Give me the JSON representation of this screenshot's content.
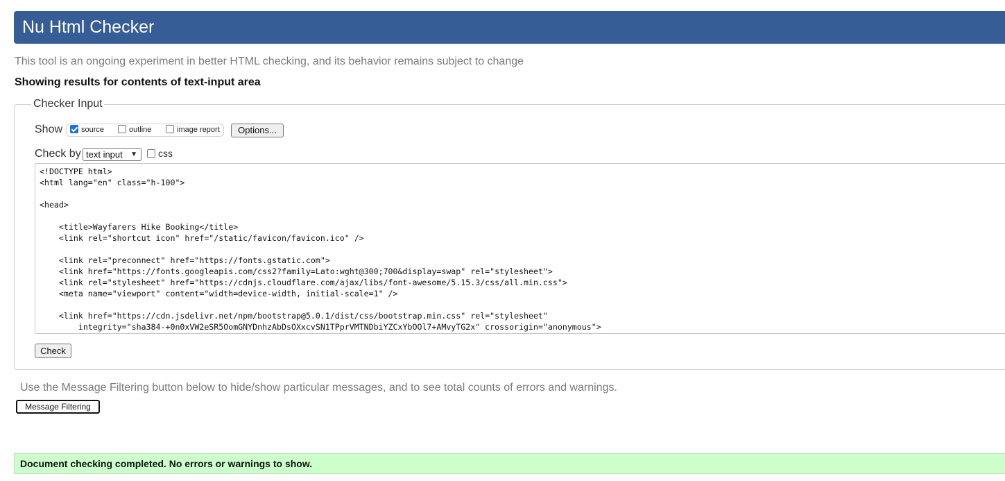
{
  "header": {
    "title": "Nu Html Checker"
  },
  "tagline": "This tool is an ongoing experiment in better HTML checking, and its behavior remains subject to change",
  "results_heading": "Showing results for contents of text-input area",
  "checker_input": {
    "legend": "Checker Input",
    "show_label": "Show",
    "options": [
      {
        "label": "source",
        "checked": true
      },
      {
        "label": "outline",
        "checked": false
      },
      {
        "label": "image report",
        "checked": false
      }
    ],
    "options_button": "Options...",
    "check_by_label": "Check by",
    "check_by_selected": "text input",
    "css_label": "css",
    "css_checked": false,
    "source_text": "<!DOCTYPE html>\n<html lang=\"en\" class=\"h-100\">\n\n<head>\n\n    <title>Wayfarers Hike Booking</title>\n    <link rel=\"shortcut icon\" href=\"/static/favicon/favicon.ico\" />\n\n    <link rel=\"preconnect\" href=\"https://fonts.gstatic.com\">\n    <link href=\"https://fonts.googleapis.com/css2?family=Lato:wght@300;700&display=swap\" rel=\"stylesheet\">\n    <link rel=\"stylesheet\" href=\"https://cdnjs.cloudflare.com/ajax/libs/font-awesome/5.15.3/css/all.min.css\">\n    <meta name=\"viewport\" content=\"width=device-width, initial-scale=1\" />\n\n    <link href=\"https://cdn.jsdelivr.net/npm/bootstrap@5.0.1/dist/css/bootstrap.min.css\" rel=\"stylesheet\"\n        integrity=\"sha384-+0n0xVW2eSR5OomGNYDnhzAbDsOXxcvSN1TPprVMTNDbiYZCxYbOOl7+AMvyTG2x\" crossorigin=\"anonymous\">",
    "check_button": "Check"
  },
  "message_filter": {
    "note": "Use the Message Filtering button below to hide/show particular messages, and to see total counts of errors and warnings.",
    "button": "Message Filtering"
  },
  "result": {
    "message": "Document checking completed. No errors or warnings to show."
  },
  "colors": {
    "header_bg": "#365d95",
    "success_bg": "#ccffcc",
    "checkbox_checked": "#1a6fd8"
  }
}
